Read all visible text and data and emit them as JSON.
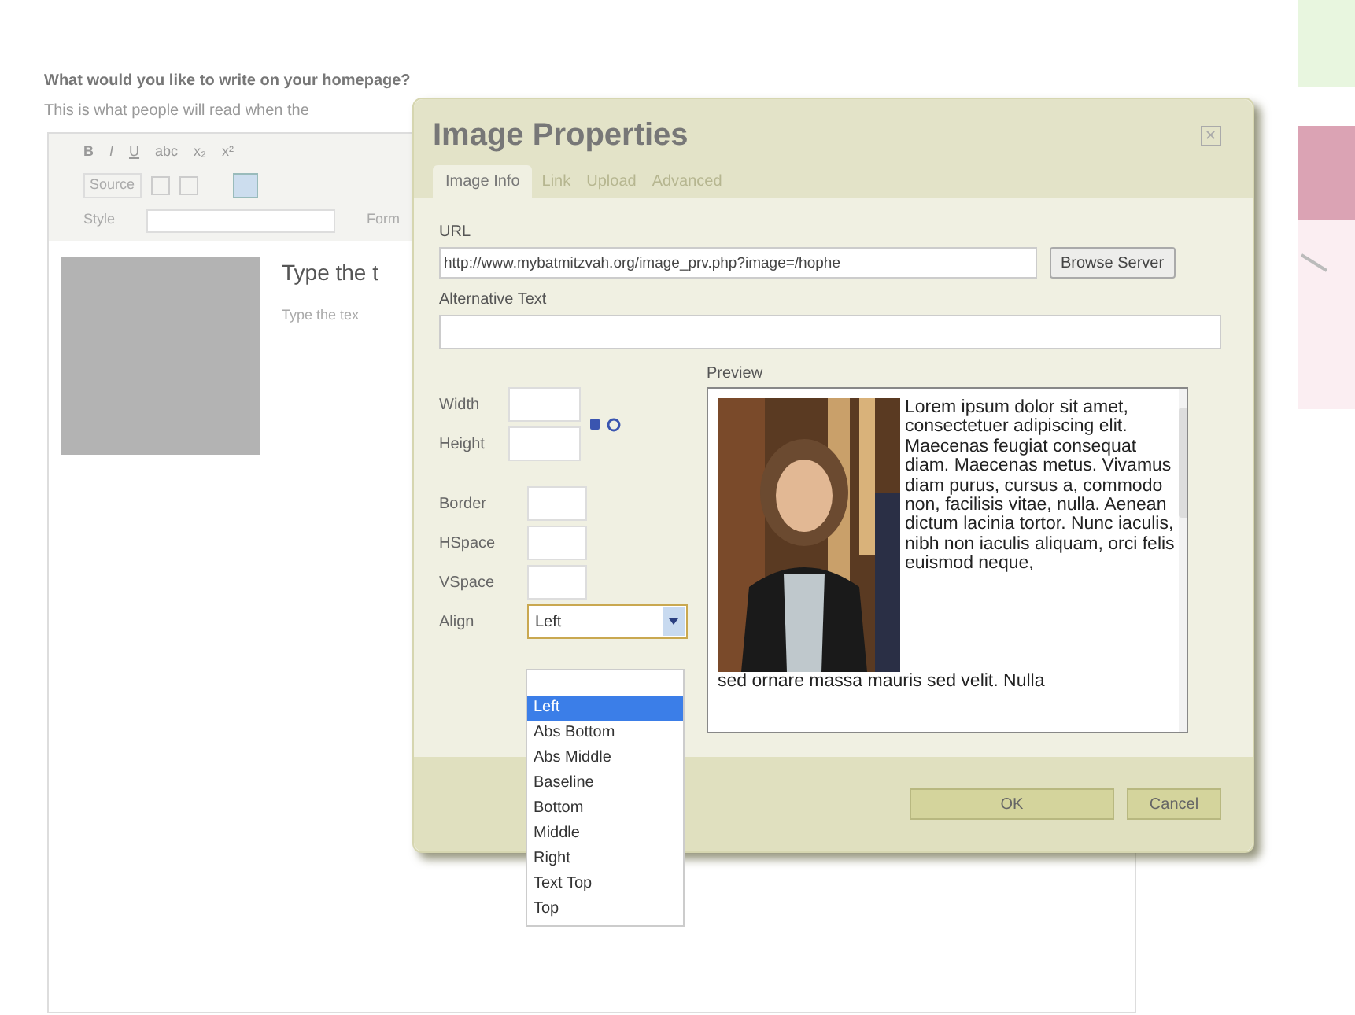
{
  "page": {
    "heading": "What would you like to write on your homepage?",
    "subheading": "This is what people will read when the"
  },
  "editor": {
    "toolbar_row1": [
      "B",
      "I",
      "U",
      "abc",
      "x₂",
      "x²"
    ],
    "source_button": "Source",
    "style_label": "Style",
    "format_label": "Form",
    "content_title": "Type the t",
    "content_text": "Type the tex"
  },
  "dialog": {
    "title": "Image Properties",
    "close_symbol": "✕",
    "tabs": [
      {
        "label": "Image Info",
        "selected": true
      },
      {
        "label": "Link",
        "selected": false
      },
      {
        "label": "Upload",
        "selected": false
      },
      {
        "label": "Advanced",
        "selected": false
      }
    ],
    "url_label": "URL",
    "url_value": "http://www.mybatmitzvah.org/image_prv.php?image=/hophe",
    "browse_button": "Browse Server",
    "alt_label": "Alternative Text",
    "size_fields": [
      {
        "label": "Width"
      },
      {
        "label": "Height"
      }
    ],
    "spacing_fields": [
      {
        "label": "Border"
      },
      {
        "label": "HSpace"
      },
      {
        "label": "VSpace"
      }
    ],
    "align_label": "Align",
    "align_value": "Left",
    "preview_label": "Preview",
    "preview_text_beside": "Lorem ipsum dolor sit amet, consectetuer adipiscing elit. Maecenas feugiat consequat diam. Maecenas metus. Vivamus diam purus, cursus a, commodo non, facilisis vitae, nulla. Aenean dictum lacinia tortor. Nunc iaculis, nibh non iaculis aliquam, orci felis euismod neque,",
    "preview_text_below": "sed ornare massa mauris sed velit. Nulla",
    "align_options": [
      {
        "label": "Left",
        "selected": true
      },
      {
        "label": "Abs Bottom",
        "selected": false
      },
      {
        "label": "Abs Middle",
        "selected": false
      },
      {
        "label": "Baseline",
        "selected": false
      },
      {
        "label": "Bottom",
        "selected": false
      },
      {
        "label": "Middle",
        "selected": false
      },
      {
        "label": "Right",
        "selected": false
      },
      {
        "label": "Text Top",
        "selected": false
      },
      {
        "label": "Top",
        "selected": false
      }
    ],
    "buttons": [
      "OK",
      "Cancel"
    ]
  }
}
